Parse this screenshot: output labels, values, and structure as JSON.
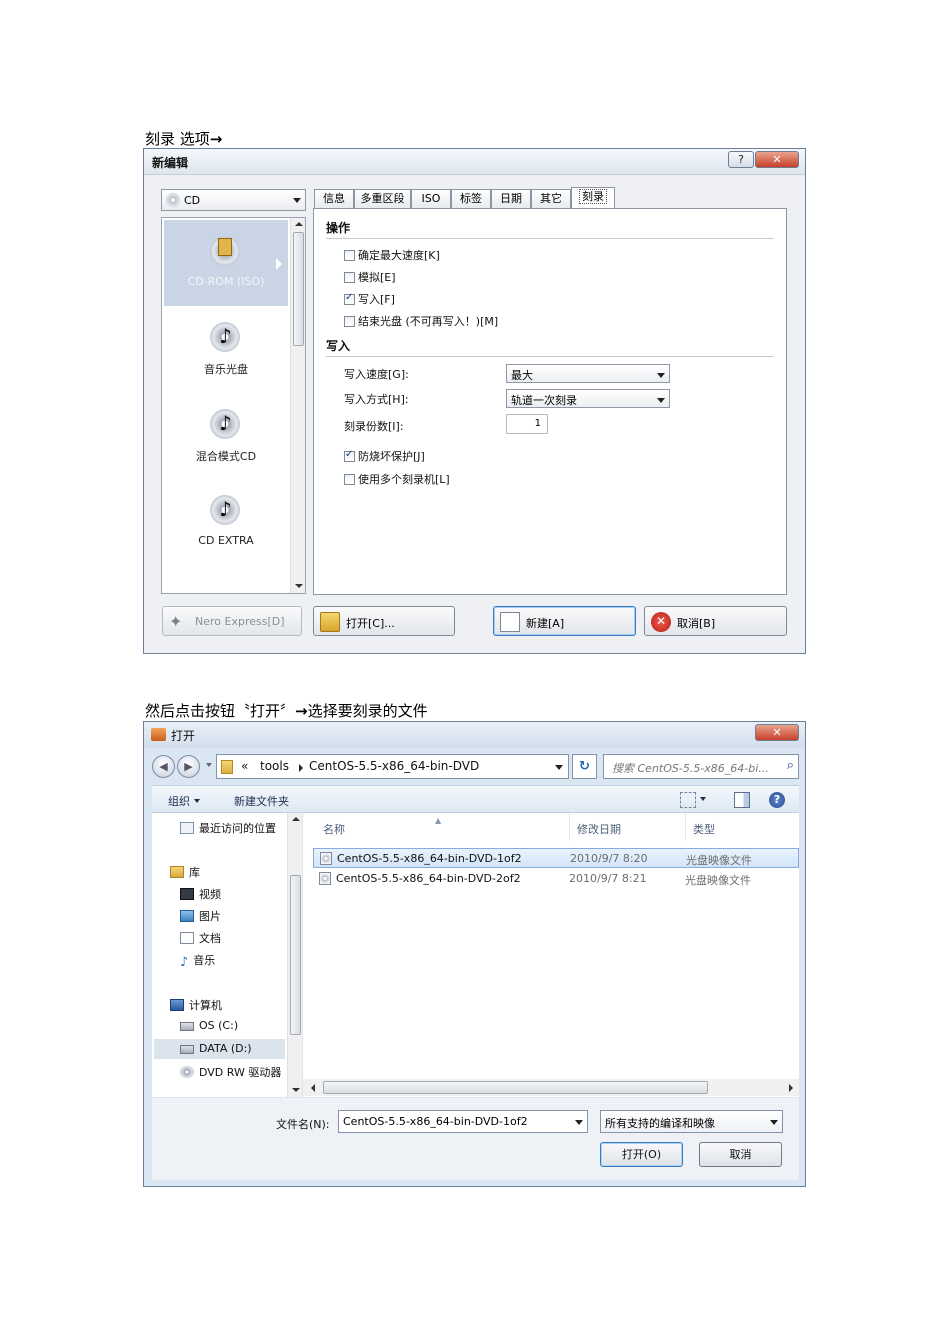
{
  "captions": {
    "first": "刻录 选项",
    "first_arrow": "→",
    "second": "然后点击按钮〝打开〞",
    "second_arrow": "→",
    "second_tail": "选择要刻录的文件"
  },
  "nero_dialog": {
    "title": "新编辑",
    "help_glyph": "?",
    "close_glyph": "✕",
    "media_selected": "CD",
    "media_items": [
      {
        "label": "CD-ROM (ISO)",
        "icon": "cd-rom-iso-icon",
        "selected": true
      },
      {
        "label": "音乐光盘",
        "icon": "music-disc-icon",
        "selected": false
      },
      {
        "label": "混合模式CD",
        "icon": "mixed-mode-cd-icon",
        "selected": false
      },
      {
        "label": "CD EXTRA",
        "icon": "cd-extra-icon",
        "selected": false
      }
    ],
    "tabs": [
      "信息",
      "多重区段",
      "ISO",
      "标签",
      "日期",
      "其它",
      "刻录"
    ],
    "active_tab": "刻录",
    "operations": {
      "heading": "操作",
      "items": [
        {
          "label": "确定最大速度[K]",
          "checked": false
        },
        {
          "label": "模拟[E]",
          "checked": false
        },
        {
          "label": "写入[F]",
          "checked": true
        },
        {
          "label": "结束光盘 (不可再写入！)[M]",
          "checked": false
        }
      ]
    },
    "write": {
      "heading": "写入",
      "speed_label": "写入速度[G]:",
      "speed_value": "最大",
      "method_label": "写入方式[H]:",
      "method_value": "轨道一次刻录",
      "copies_label": "刻录份数[I]:",
      "copies_value": "1",
      "options": [
        {
          "label": "防烧坏保护[J]",
          "checked": true
        },
        {
          "label": "使用多个刻录机[L]",
          "checked": false
        }
      ]
    },
    "buttons": {
      "nero_express": "Nero Express[D]",
      "open": "打开[C]...",
      "new": "新建[A]",
      "cancel": "取消[B]"
    }
  },
  "open_dialog": {
    "title": "打开",
    "close_glyph": "✕",
    "breadcrumb": [
      "«",
      "tools",
      "CentOS-5.5-x86_64-bin-DVD"
    ],
    "search_placeholder": "搜索 CentOS-5.5-x86_64-bi...",
    "toolbar": {
      "organize": "组织",
      "new_folder": "新建文件夹"
    },
    "nav": {
      "recent": "最近访问的位置",
      "libraries": "库",
      "videos": "视频",
      "pictures": "图片",
      "documents": "文档",
      "music": "音乐",
      "computer": "计算机",
      "os_drive": "OS (C:)",
      "data_drive": "DATA (D:)",
      "dvd_drive": "DVD RW 驱动器"
    },
    "columns": {
      "name": "名称",
      "date": "修改日期",
      "type": "类型"
    },
    "files": [
      {
        "name": "CentOS-5.5-x86_64-bin-DVD-1of2",
        "date": "2010/9/7 8:20",
        "type": "光盘映像文件",
        "selected": true
      },
      {
        "name": "CentOS-5.5-x86_64-bin-DVD-2of2",
        "date": "2010/9/7 8:21",
        "type": "光盘映像文件",
        "selected": false
      }
    ],
    "filename_label": "文件名(N):",
    "filename_value": "CentOS-5.5-x86_64-bin-DVD-1of2",
    "filetype_value": "所有支持的编译和映像",
    "open_button": "打开(O)",
    "cancel_button": "取消"
  }
}
